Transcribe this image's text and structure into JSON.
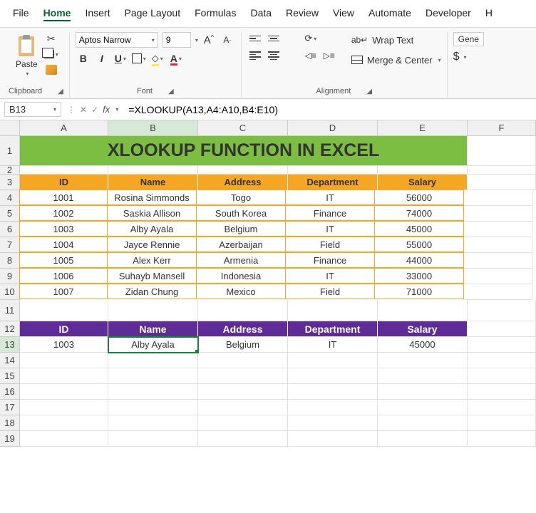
{
  "menu": [
    "File",
    "Home",
    "Insert",
    "Page Layout",
    "Formulas",
    "Data",
    "Review",
    "View",
    "Automate",
    "Developer",
    "H"
  ],
  "active_menu": "Home",
  "ribbon": {
    "clipboard": {
      "paste": "Paste",
      "label": "Clipboard"
    },
    "font": {
      "name": "Aptos Narrow",
      "size": "9",
      "bold": "B",
      "italic": "I",
      "underline": "U",
      "font_color_letter": "A",
      "size_up": "A",
      "size_down": "A",
      "label": "Font"
    },
    "alignment": {
      "wrap": "Wrap Text",
      "merge": "Merge & Center",
      "label": "Alignment"
    },
    "number": {
      "general": "Gene",
      "dollar": "$"
    }
  },
  "name_box": "B13",
  "formula_fx": "fx",
  "formula": "=XLOOKUP(A13,A4:A10,B4:E10)",
  "columns": [
    "A",
    "B",
    "C",
    "D",
    "E",
    "F"
  ],
  "rows": [
    "1",
    "2",
    "3",
    "4",
    "5",
    "6",
    "7",
    "8",
    "9",
    "10",
    "11",
    "12",
    "13",
    "14",
    "15",
    "16",
    "17",
    "18",
    "19"
  ],
  "title": "XLOOKUP FUNCTION IN EXCEL",
  "headers": [
    "ID",
    "Name",
    "Address",
    "Department",
    "Salary"
  ],
  "table": [
    [
      "1001",
      "Rosina Simmonds",
      "Togo",
      "IT",
      "56000"
    ],
    [
      "1002",
      "Saskia Allison",
      "South Korea",
      "Finance",
      "74000"
    ],
    [
      "1003",
      "Alby Ayala",
      "Belgium",
      "IT",
      "45000"
    ],
    [
      "1004",
      "Jayce Rennie",
      "Azerbaijan",
      "Field",
      "55000"
    ],
    [
      "1005",
      "Alex Kerr",
      "Armenia",
      "Finance",
      "44000"
    ],
    [
      "1006",
      "Suhayb Mansell",
      "Indonesia",
      "IT",
      "33000"
    ],
    [
      "1007",
      "Zidan Chung",
      "Mexico",
      "Field",
      "71000"
    ]
  ],
  "lookup_headers": [
    "ID",
    "Name",
    "Address",
    "Department",
    "Salary"
  ],
  "lookup_row": [
    "1003",
    "Alby Ayala",
    "Belgium",
    "IT",
    "45000"
  ],
  "chart_data": {
    "type": "table",
    "columns": [
      "ID",
      "Name",
      "Address",
      "Department",
      "Salary"
    ],
    "rows": [
      [
        1001,
        "Rosina Simmonds",
        "Togo",
        "IT",
        56000
      ],
      [
        1002,
        "Saskia Allison",
        "South Korea",
        "Finance",
        74000
      ],
      [
        1003,
        "Alby Ayala",
        "Belgium",
        "IT",
        45000
      ],
      [
        1004,
        "Jayce Rennie",
        "Azerbaijan",
        "Field",
        55000
      ],
      [
        1005,
        "Alex Kerr",
        "Armenia",
        "Finance",
        44000
      ],
      [
        1006,
        "Suhayb Mansell",
        "Indonesia",
        "IT",
        33000
      ],
      [
        1007,
        "Zidan Chung",
        "Mexico",
        "Field",
        71000
      ]
    ]
  }
}
